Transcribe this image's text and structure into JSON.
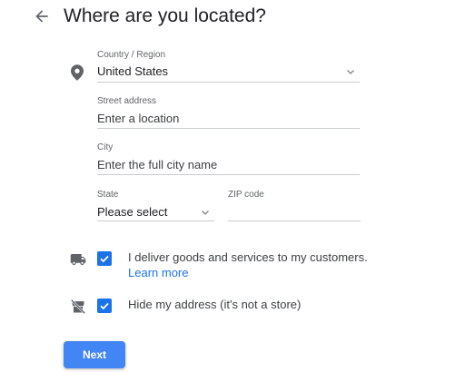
{
  "header": {
    "title": "Where are you located?",
    "back_icon": "arrow-back-icon"
  },
  "form": {
    "country": {
      "label": "Country / Region",
      "value": "United States"
    },
    "street": {
      "label": "Street address",
      "placeholder": "Enter a location"
    },
    "city": {
      "label": "City",
      "placeholder": "Enter the full city name"
    },
    "state": {
      "label": "State",
      "value": "Please select"
    },
    "zip": {
      "label": "ZIP code",
      "value": ""
    }
  },
  "options": {
    "deliver": {
      "label": "I deliver goods and services to my customers.",
      "link": "Learn more",
      "checked": true
    },
    "hide_address": {
      "label": "Hide my address (it's not a store)",
      "checked": true
    }
  },
  "actions": {
    "next_label": "Next"
  },
  "colors": {
    "accent": "#1a73e8",
    "button": "#4285f4",
    "icon": "#5f6368"
  }
}
